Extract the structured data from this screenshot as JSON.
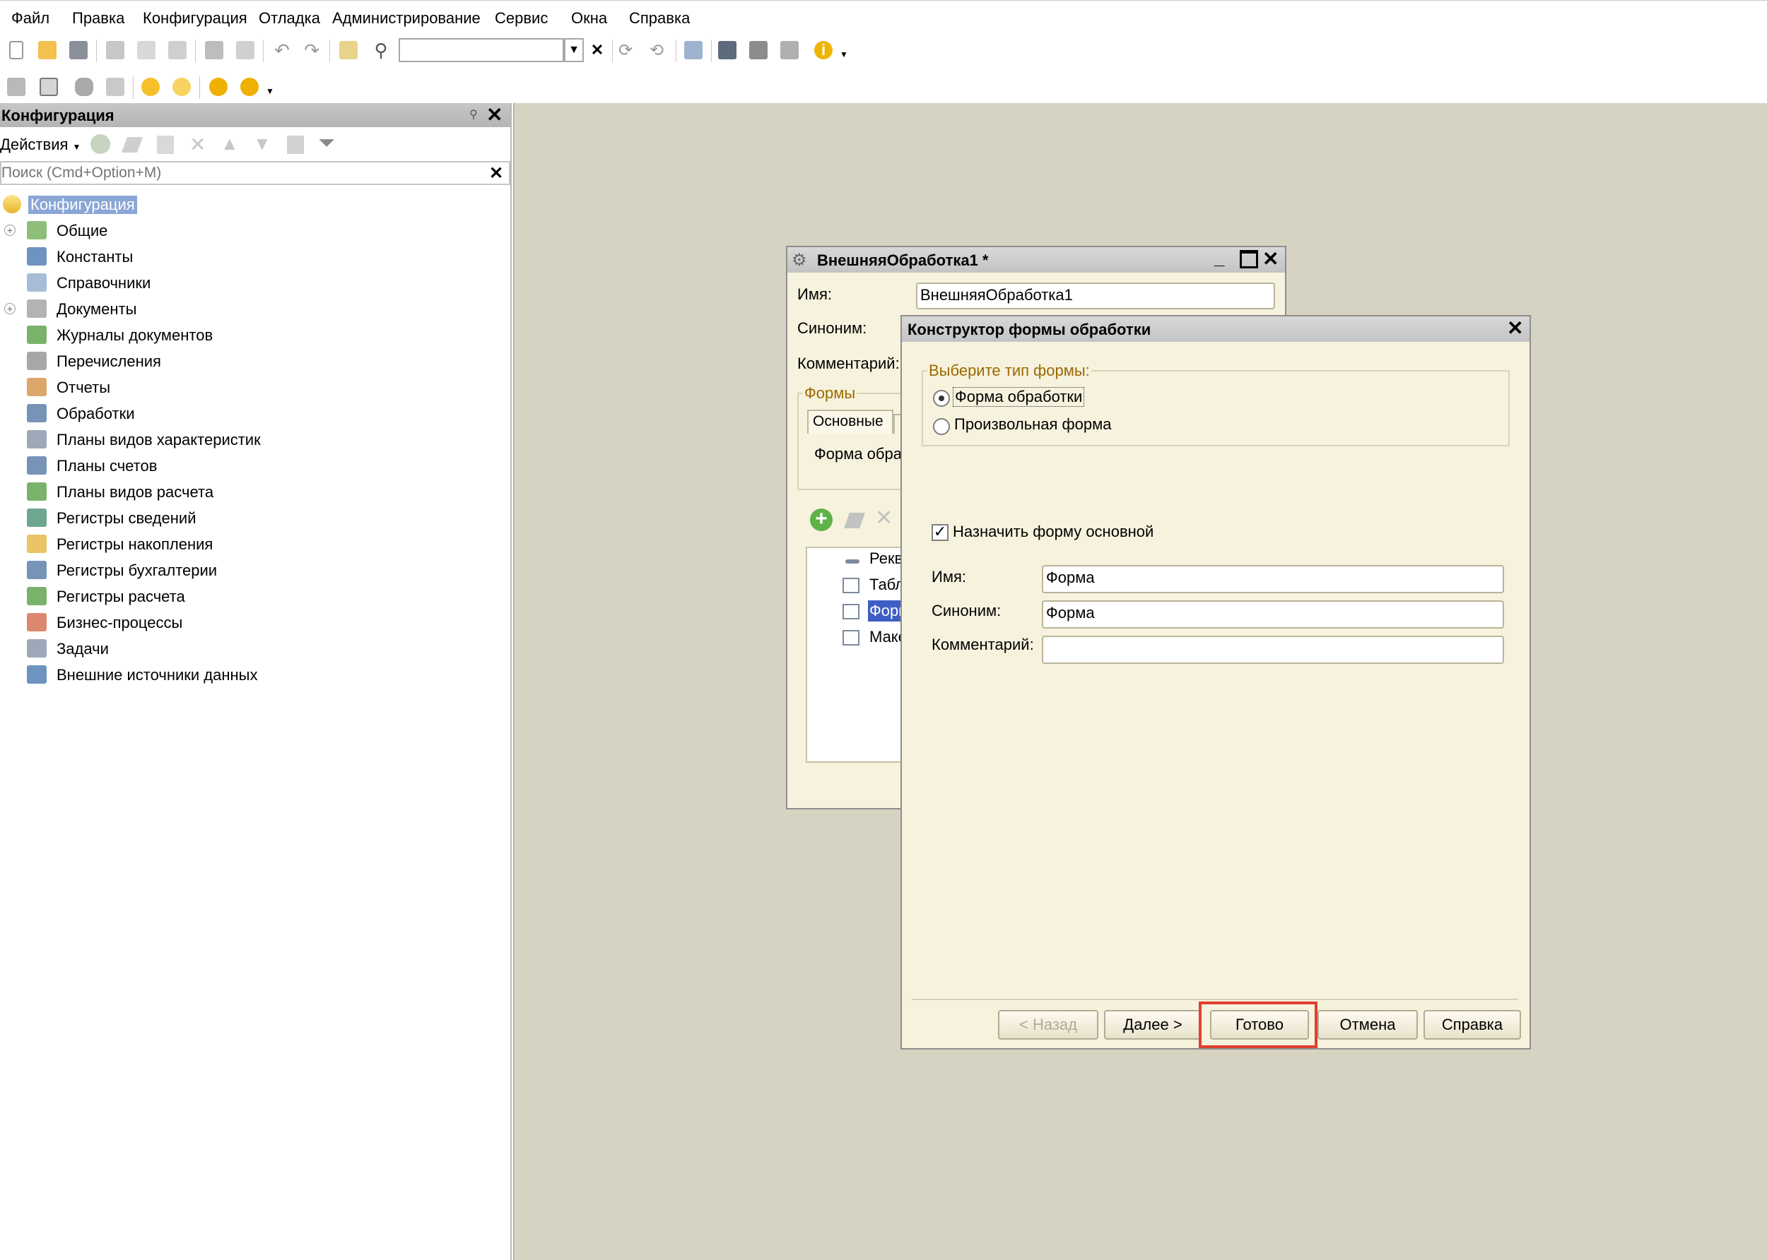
{
  "menu": [
    "Файл",
    "Правка",
    "Конфигурация",
    "Отладка",
    "Администрирование",
    "Сервис",
    "Окна",
    "Справка"
  ],
  "toolbar": {
    "search_value": ""
  },
  "left_panel": {
    "title": "Конфигурация",
    "actions_label": "Действия",
    "search_placeholder": "Поиск (Cmd+Option+M)",
    "tree": [
      {
        "label": "Конфигурация",
        "icon": "configuration-icon",
        "selected": true
      },
      {
        "label": "Общие",
        "icon": "common-icon",
        "expandable": true
      },
      {
        "label": "Константы",
        "icon": "constants-icon"
      },
      {
        "label": "Справочники",
        "icon": "catalogs-icon"
      },
      {
        "label": "Документы",
        "icon": "documents-icon",
        "expandable": true
      },
      {
        "label": "Журналы документов",
        "icon": "document-journals-icon"
      },
      {
        "label": "Перечисления",
        "icon": "enumerations-icon"
      },
      {
        "label": "Отчеты",
        "icon": "reports-icon"
      },
      {
        "label": "Обработки",
        "icon": "data-processors-icon"
      },
      {
        "label": "Планы видов характеристик",
        "icon": "characteristic-types-icon"
      },
      {
        "label": "Планы счетов",
        "icon": "charts-of-accounts-icon"
      },
      {
        "label": "Планы видов расчета",
        "icon": "calculation-types-icon"
      },
      {
        "label": "Регистры сведений",
        "icon": "information-registers-icon"
      },
      {
        "label": "Регистры накопления",
        "icon": "accumulation-registers-icon"
      },
      {
        "label": "Регистры бухгалтерии",
        "icon": "accounting-registers-icon"
      },
      {
        "label": "Регистры расчета",
        "icon": "calculation-registers-icon"
      },
      {
        "label": "Бизнес-процессы",
        "icon": "business-processes-icon"
      },
      {
        "label": "Задачи",
        "icon": "tasks-icon"
      },
      {
        "label": "Внешние источники данных",
        "icon": "external-data-sources-icon"
      }
    ]
  },
  "processor_window": {
    "title": "ВнешняяОбработка1 *",
    "name_label": "Имя:",
    "name_value": "ВнешняяОбработка1",
    "synonym_label": "Синоним:",
    "comment_label": "Комментарий:",
    "forms_group": "Формы",
    "tab_main": "Основные",
    "forms_text": "Форма обра",
    "tree_items": [
      "Рекв",
      "Табл",
      "Форм",
      "Маке"
    ]
  },
  "wizard": {
    "title": "Конструктор формы обработки",
    "group_label": "Выберите тип формы:",
    "radio_options": [
      {
        "label": "Форма обработки",
        "checked": true
      },
      {
        "label": "Произвольная форма",
        "checked": false
      }
    ],
    "checkbox_label": "Назначить форму основной",
    "checkbox_checked": true,
    "name_label": "Имя:",
    "name_value": "Форма",
    "synonym_label": "Синоним:",
    "synonym_value": "Форма",
    "comment_label": "Комментарий:",
    "comment_value": "",
    "buttons": {
      "back": "< Назад",
      "next": "Далее >",
      "done": "Готово",
      "cancel": "Отмена",
      "help": "Справка"
    }
  },
  "colors": {
    "workspace_bg": "#d6d3c2",
    "dialog_bg": "#f6f2dd",
    "selection": "#8aa6d6",
    "highlight_frame": "#e0402f",
    "group_label_color": "#9a6a00"
  }
}
